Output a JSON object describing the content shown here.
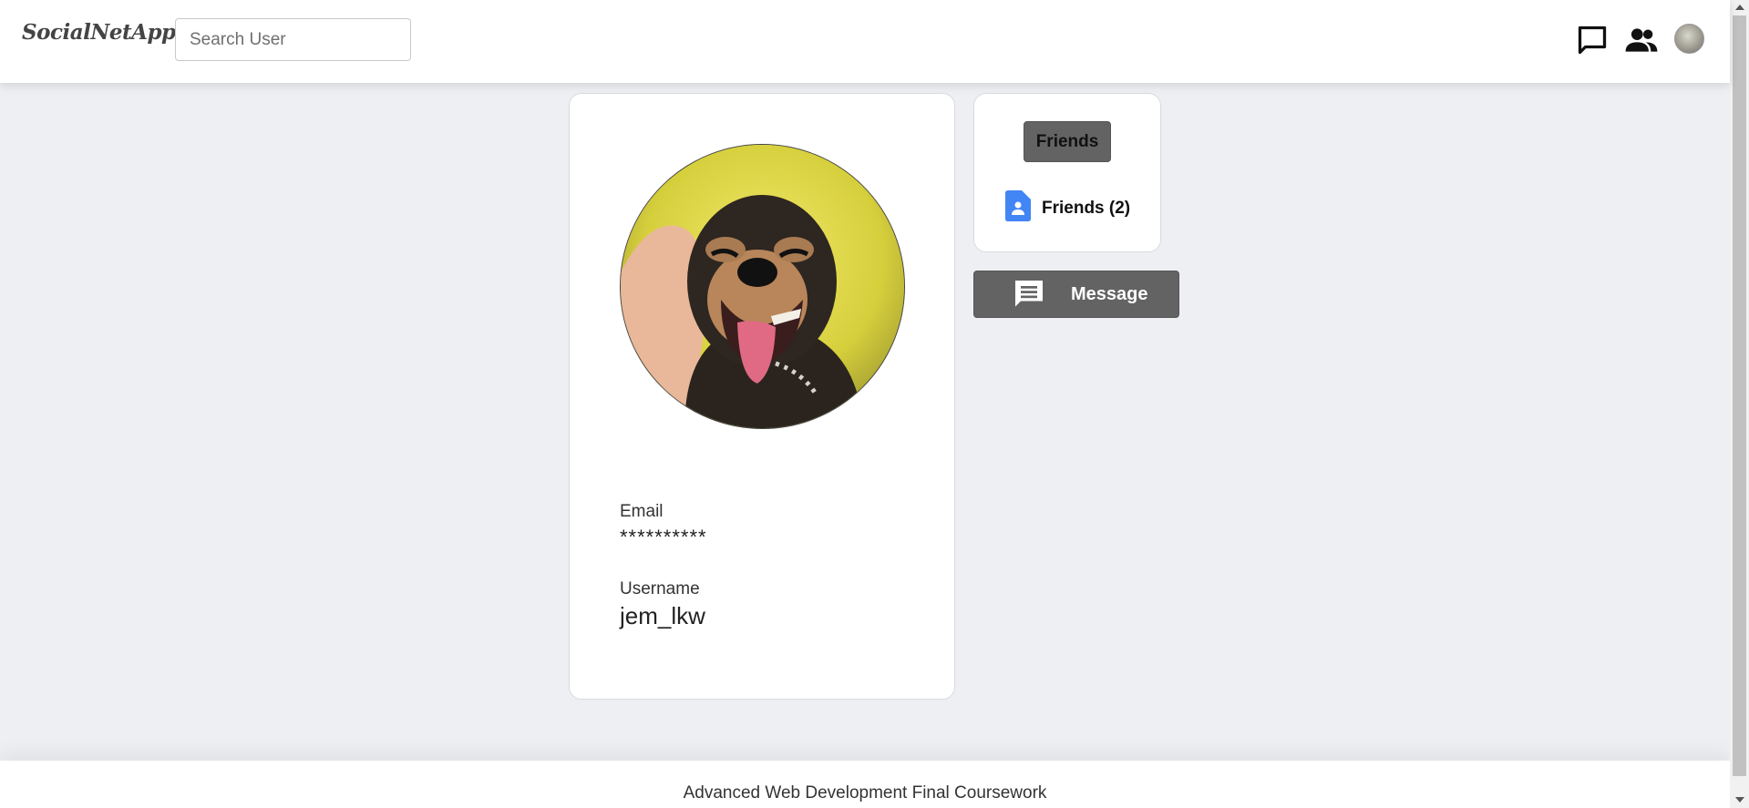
{
  "app": {
    "brand": "SocialNetApp"
  },
  "header": {
    "search_placeholder": "Search User",
    "icons": [
      "chat-icon",
      "friends-icon",
      "user-avatar"
    ]
  },
  "profile": {
    "avatar": "dog-photo",
    "email_label": "Email",
    "email_value": "**********",
    "username_label": "Username",
    "username_value": "jem_lkw"
  },
  "friends_panel": {
    "button_label": "Friends",
    "link_label": "Friends (2)",
    "link_icon": "contact-file-icon",
    "icon_color": "#4285f4"
  },
  "actions": {
    "message_label": "Message",
    "message_icon": "message-icon"
  },
  "footer": {
    "text": "Advanced Web Development Final Coursework"
  },
  "colors": {
    "page_bg": "#eeeff3",
    "button_bg": "#636363",
    "card_bg": "#ffffff"
  }
}
